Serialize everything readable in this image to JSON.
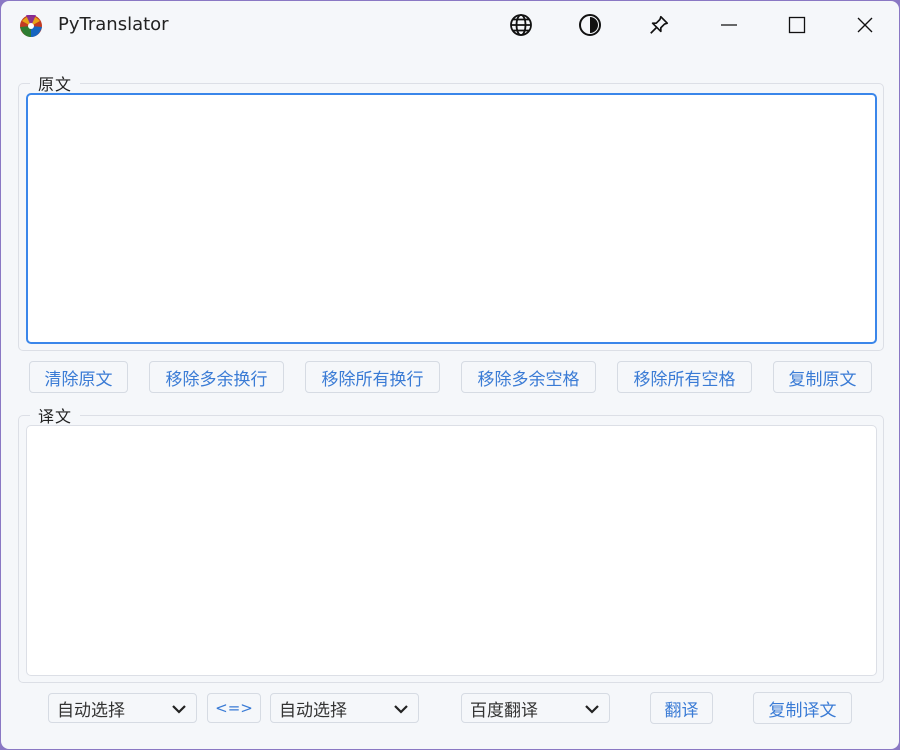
{
  "app": {
    "title": "PyTranslator"
  },
  "titlebar": {
    "icons": [
      "globe-icon",
      "contrast-icon",
      "pin-icon",
      "minimize-icon",
      "maximize-icon",
      "close-icon"
    ]
  },
  "source": {
    "label": "原文",
    "text": ""
  },
  "source_actions": [
    "清除原文",
    "移除多余换行",
    "移除所有换行",
    "移除多余空格",
    "移除所有空格",
    "复制原文"
  ],
  "target": {
    "label": "译文",
    "text": ""
  },
  "bottom": {
    "from_lang": "自动选择",
    "swap_label": "<=>",
    "to_lang": "自动选择",
    "engine": "百度翻译",
    "translate_label": "翻译",
    "copy_label": "复制译文"
  },
  "colors": {
    "accent": "#3a7bd5",
    "focus_border": "#3a86ea",
    "window_bg": "#f5f7fa"
  }
}
